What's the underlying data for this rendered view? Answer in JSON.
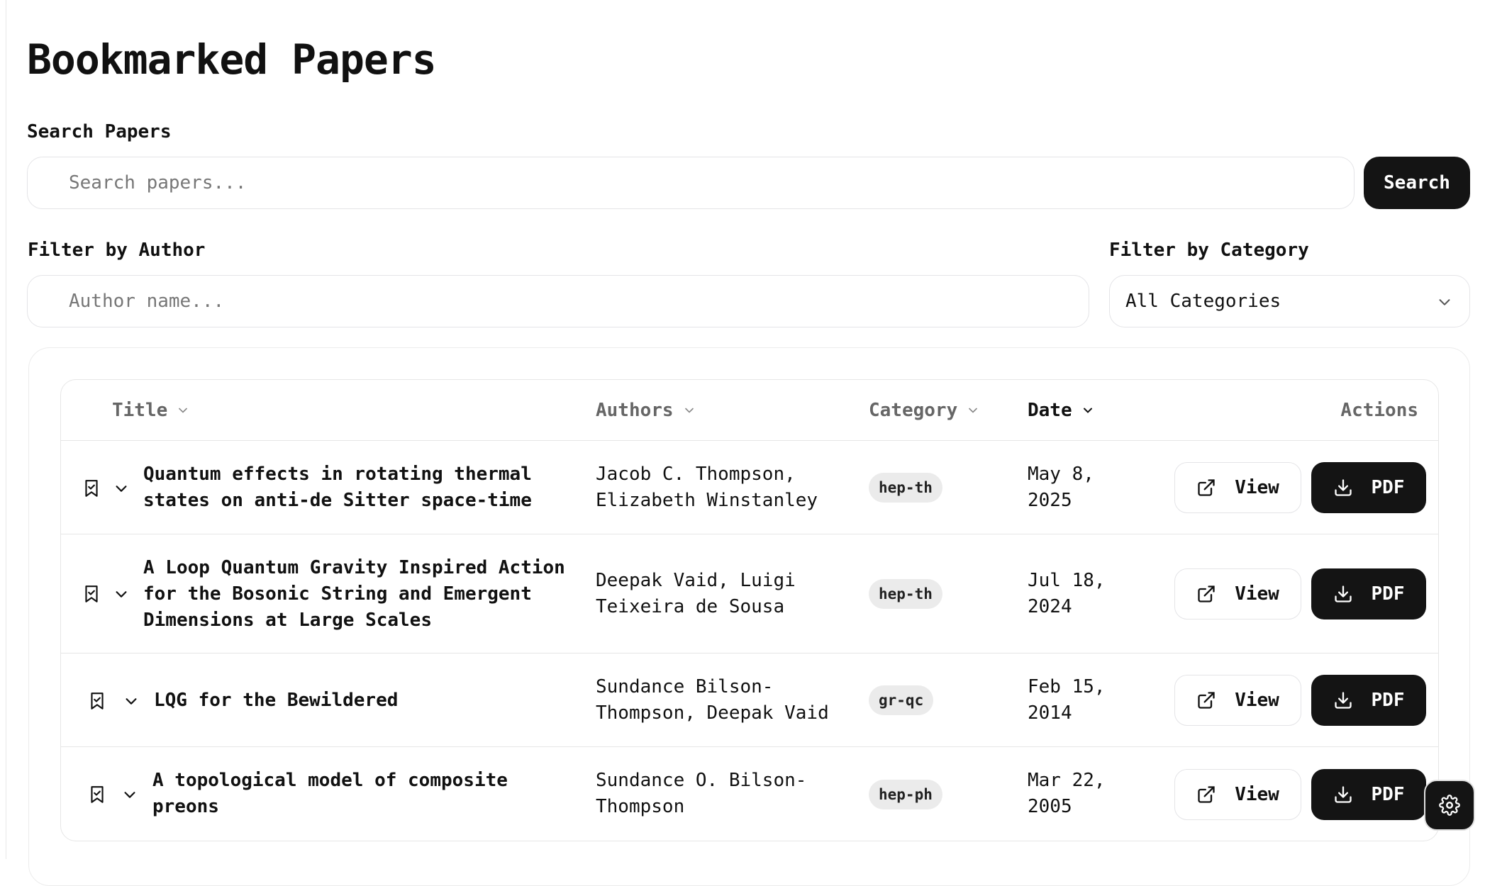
{
  "page": {
    "title": "Bookmarked Papers"
  },
  "search": {
    "label": "Search Papers",
    "placeholder": "Search papers...",
    "button_label": "Search"
  },
  "filters": {
    "author_label": "Filter by Author",
    "author_placeholder": "Author name...",
    "category_label": "Filter by Category",
    "category_selected": "All Categories"
  },
  "table": {
    "headers": {
      "title": "Title",
      "authors": "Authors",
      "category": "Category",
      "date": "Date",
      "actions": "Actions"
    },
    "rows": [
      {
        "title": "Quantum effects in rotating thermal\nstates on anti-de Sitter space-time",
        "authors": "Jacob C. Thompson,\nElizabeth Winstanley",
        "category": "hep-th",
        "date": "May 8,\n2025"
      },
      {
        "title": "A Loop Quantum Gravity Inspired Action\nfor the Bosonic String and Emergent\nDimensions at Large Scales",
        "authors": "Deepak Vaid, Luigi\nTeixeira de Sousa",
        "category": "hep-th",
        "date": "Jul 18,\n2024"
      },
      {
        "title": "LQG for the Bewildered",
        "authors": "Sundance Bilson-\nThompson, Deepak Vaid",
        "category": "gr-qc",
        "date": "Feb 15,\n2014"
      },
      {
        "title": "A topological model of composite\npreons",
        "authors": "Sundance O. Bilson-\nThompson",
        "category": "hep-ph",
        "date": "Mar 22,\n2005"
      }
    ],
    "view_label": "View",
    "pdf_label": "PDF"
  },
  "icons": {
    "bookmark": "bookmark-check-icon",
    "expand": "chevron-down-icon",
    "view": "external-link-icon",
    "pdf": "download-icon",
    "settings": "gear-icon"
  },
  "colors": {
    "primary": "#141414",
    "border": "#e4e4e7",
    "badge_bg": "#ebebeb",
    "muted": "#666666"
  }
}
